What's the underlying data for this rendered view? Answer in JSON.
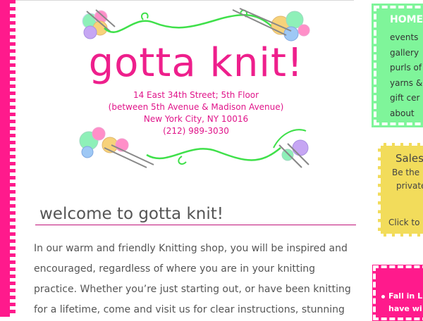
{
  "logo": {
    "title": "gotta knit!",
    "address_lines": [
      "14 East 34th Street; 5th Floor",
      "(between 5th Avenue & Madison Avenue)",
      "New York City, NY 10016",
      "(212) 989-3030"
    ]
  },
  "main": {
    "heading": "welcome to gotta knit!",
    "paragraph_lines": [
      "In our warm and friendly Knitting shop, you will be inspired and",
      "encouraged, regardless of where you are in your knitting",
      "practice. Whether you’re just starting out, or have been knitting",
      "for a lifetime, come and visit us for clear instructions, stunning"
    ]
  },
  "nav": {
    "home": "HOME",
    "items": [
      "events",
      "gallery",
      "purls of",
      "yarns &",
      "gift cer",
      "about"
    ]
  },
  "sales": {
    "title": "Sales",
    "line1": "Be the",
    "line2": "private",
    "click": "Click to"
  },
  "news": {
    "line1": "Fall in L",
    "line2": "have wi"
  },
  "colors": {
    "pink": "#ff1a8c",
    "green": "#7ff59a",
    "yellow": "#f2dc5b"
  }
}
